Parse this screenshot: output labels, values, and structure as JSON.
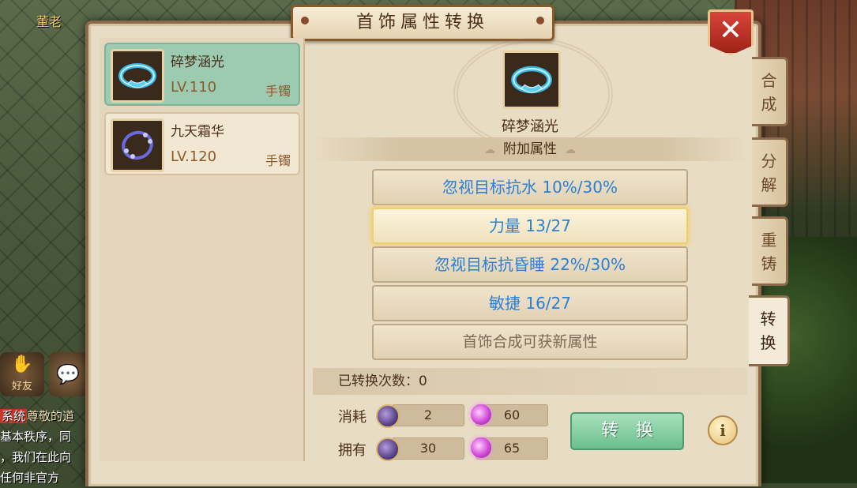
{
  "world": {
    "npc_name": "董老",
    "friend_label": "好友",
    "chat_lines": [
      {
        "tag": "系统",
        "text": "尊敬的道"
      },
      {
        "tag": "",
        "text": "基本秩序，同"
      },
      {
        "tag": "",
        "text": "，我们在此向"
      },
      {
        "tag": "",
        "text": "任何非官方"
      }
    ]
  },
  "panel": {
    "title": "首饰属性转换",
    "close_icon": "close-icon"
  },
  "items": [
    {
      "name": "碎梦涵光",
      "level": "LV.110",
      "type": "手镯",
      "selected": true,
      "icon": "bracelet-cyan-icon"
    },
    {
      "name": "九天霜华",
      "level": "LV.120",
      "type": "手镯",
      "selected": false,
      "icon": "bracelet-purple-icon"
    }
  ],
  "preview": {
    "name": "碎梦涵光",
    "icon": "bracelet-cyan-icon"
  },
  "attributes": {
    "header": "附加属性",
    "rows": [
      {
        "text": "忽视目标抗水  10%/30%",
        "selected": false
      },
      {
        "text": "力量  13/27",
        "selected": true
      },
      {
        "text": "忽视目标抗昏睡  22%/30%",
        "selected": false
      },
      {
        "text": "敏捷  16/27",
        "selected": false
      },
      {
        "text": "首饰合成可获新属性",
        "selected": false
      }
    ]
  },
  "convert_count": "已转换次数：0",
  "resources": {
    "cost_label": "消耗",
    "own_label": "拥有",
    "cost_stone": "2",
    "cost_orb": "60",
    "own_stone": "30",
    "own_orb": "65"
  },
  "convert_button": "转换",
  "info_button": "i",
  "side_tabs": [
    {
      "chars": [
        "合",
        "成"
      ],
      "active": false
    },
    {
      "chars": [
        "分",
        "解"
      ],
      "active": false
    },
    {
      "chars": [
        "重",
        "铸"
      ],
      "active": false
    },
    {
      "chars": [
        "转",
        "换"
      ],
      "active": true
    }
  ]
}
